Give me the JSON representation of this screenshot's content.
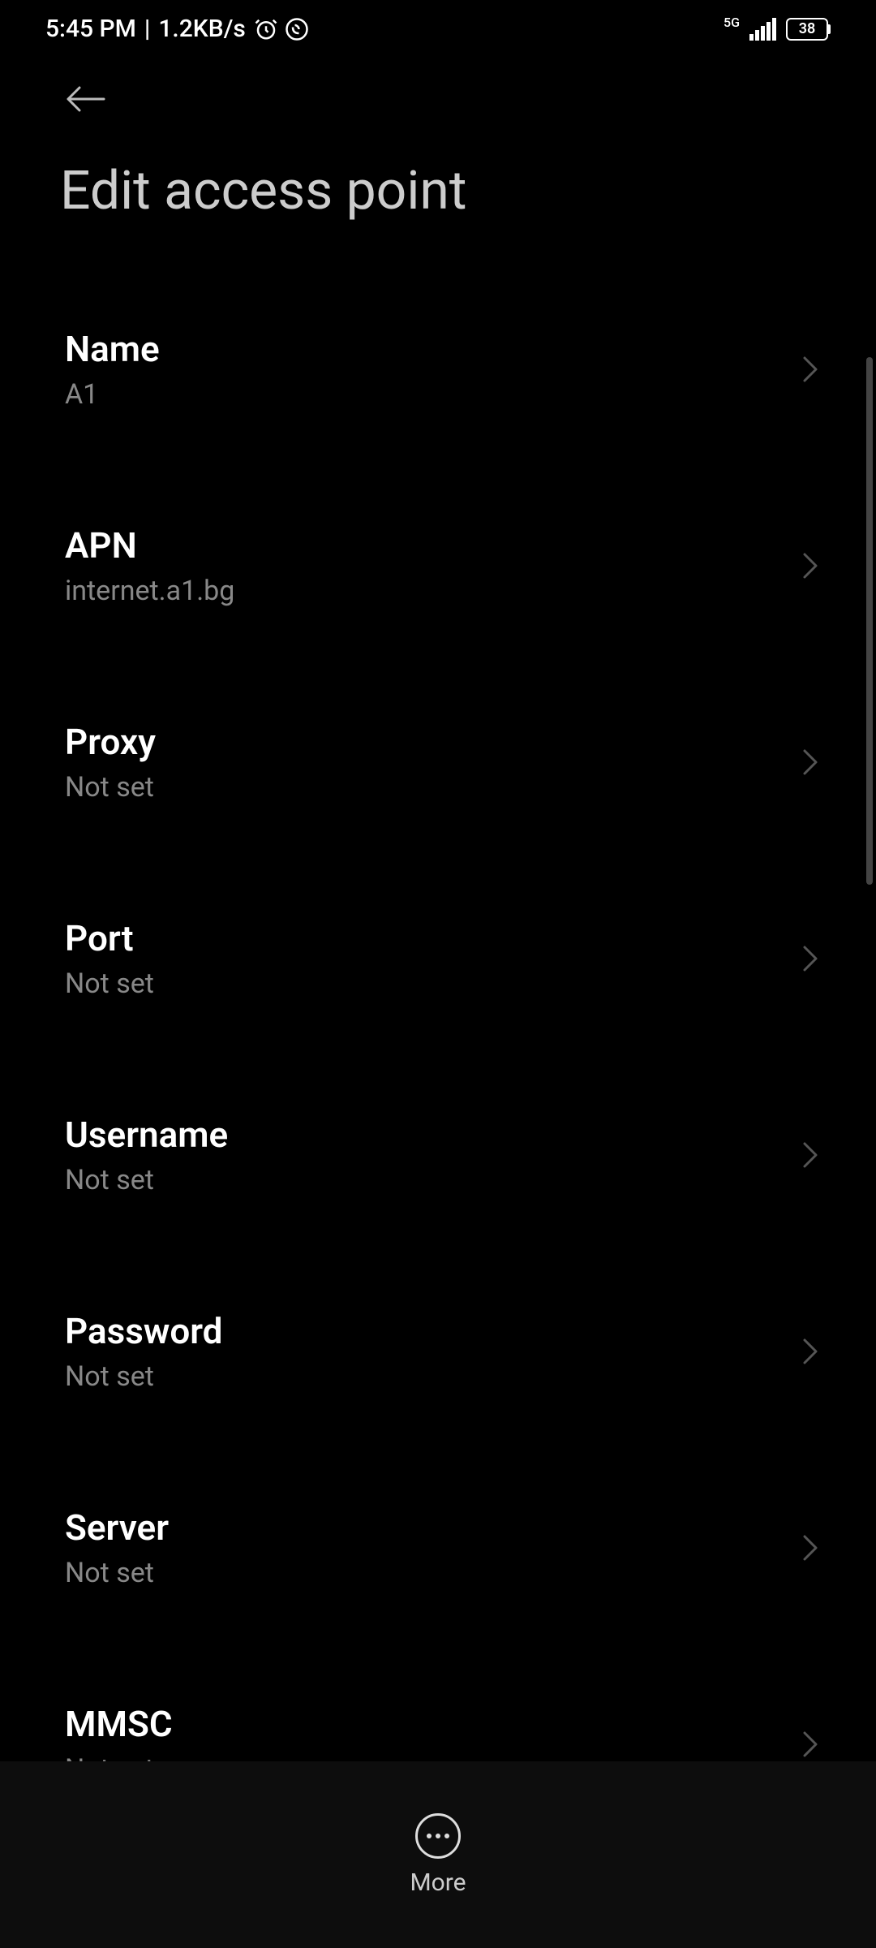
{
  "statusBar": {
    "time": "5:45 PM",
    "speed": "1.2KB/s",
    "networkType": "5G",
    "batteryLevel": "38"
  },
  "header": {
    "title": "Edit access point"
  },
  "settings": {
    "name": {
      "label": "Name",
      "value": "A1"
    },
    "apn": {
      "label": "APN",
      "value": "internet.a1.bg"
    },
    "proxy": {
      "label": "Proxy",
      "value": "Not set"
    },
    "port": {
      "label": "Port",
      "value": "Not set"
    },
    "username": {
      "label": "Username",
      "value": "Not set"
    },
    "password": {
      "label": "Password",
      "value": "Not set"
    },
    "server": {
      "label": "Server",
      "value": "Not set"
    },
    "mmsc": {
      "label": "MMSC",
      "value": "Not set"
    }
  },
  "bottomBar": {
    "moreLabel": "More"
  }
}
